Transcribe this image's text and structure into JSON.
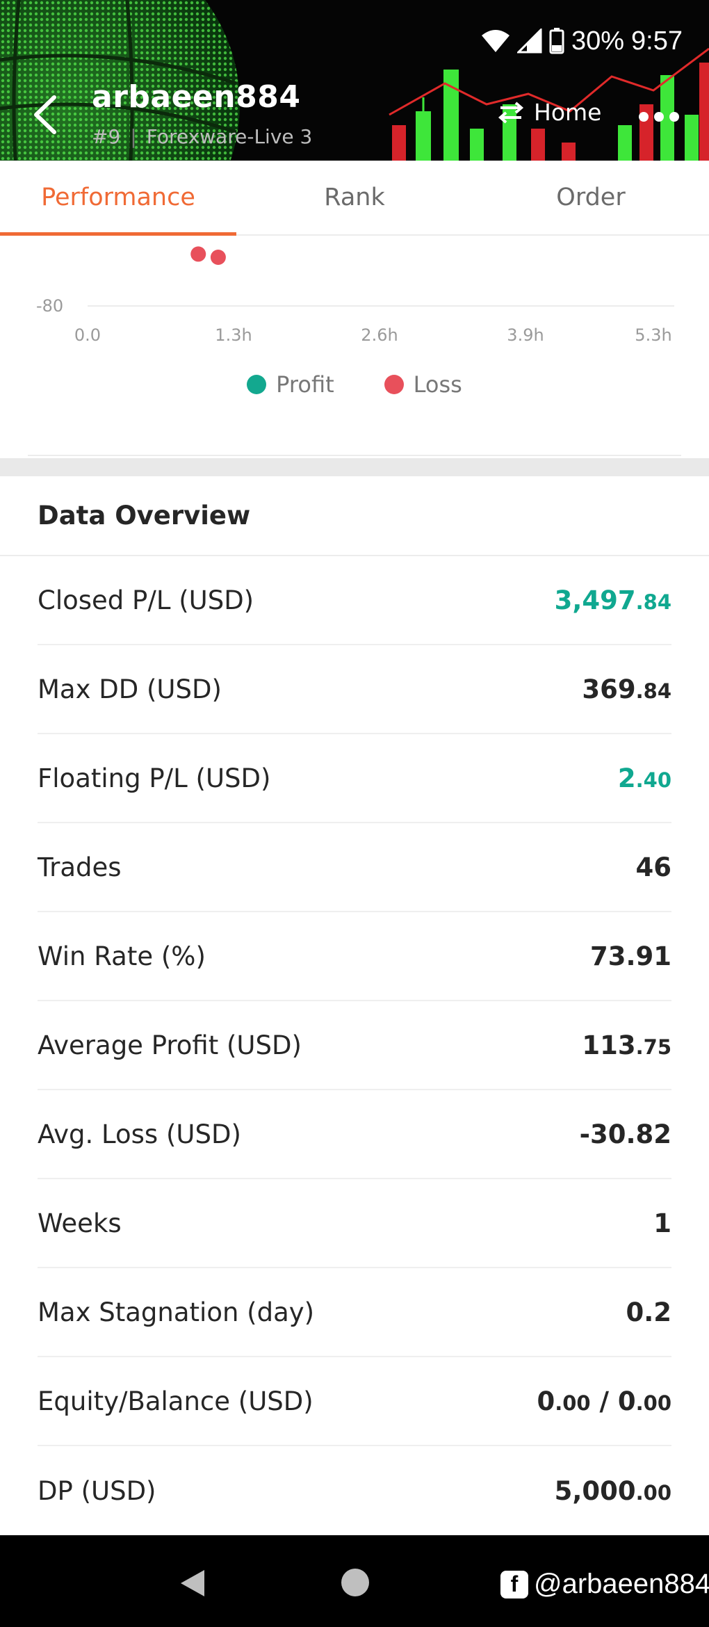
{
  "status_bar": {
    "battery": "30%",
    "time": "9:57"
  },
  "header": {
    "title": "arbaeen884",
    "rank": "#9",
    "server": "Forexware-Live 3",
    "home_label": "Home"
  },
  "tabs": [
    {
      "label": "Performance",
      "active": true
    },
    {
      "label": "Rank",
      "active": false
    },
    {
      "label": "Order",
      "active": false
    }
  ],
  "chart_data": {
    "type": "scatter",
    "y_tick_labels": [
      "-80"
    ],
    "x_tick_labels": [
      "0.0",
      "1.3h",
      "2.6h",
      "3.9h",
      "5.3h"
    ],
    "series": [
      {
        "name": "Profit",
        "color": "#13a88f",
        "points": []
      },
      {
        "name": "Loss",
        "color": "#e8505b",
        "points": [
          {
            "x": 1.0,
            "y": -76
          },
          {
            "x": 1.18,
            "y": -80
          }
        ]
      }
    ],
    "legend_position": "bottom-center",
    "grid": true
  },
  "overview": {
    "title": "Data Overview",
    "rows": [
      {
        "label": "Closed P/L (USD)",
        "int": "3,497",
        "dec": ".84",
        "positive": true
      },
      {
        "label": "Max DD (USD)",
        "int": "369",
        "dec": ".84",
        "positive": false
      },
      {
        "label": "Floating P/L (USD)",
        "int": "2",
        "dec": ".40",
        "positive": true
      },
      {
        "label": "Trades",
        "int": "46",
        "dec": "",
        "positive": false
      },
      {
        "label": "Win Rate (%)",
        "int": "73.91",
        "dec": "",
        "positive": false
      },
      {
        "label": "Average Profit (USD)",
        "int": "113",
        "dec": ".75",
        "positive": false
      },
      {
        "label": "Avg. Loss (USD)",
        "int": "-30.82",
        "dec": "",
        "positive": false
      },
      {
        "label": "Weeks",
        "int": "1",
        "dec": "",
        "positive": false
      },
      {
        "label": "Max Stagnation (day)",
        "int": "0.2",
        "dec": "",
        "positive": false
      },
      {
        "label": "Equity/Balance (USD)",
        "int": "0",
        "dec": ".00",
        "sep": " / ",
        "int2": "0",
        "dec2": ".00",
        "positive": false
      },
      {
        "label": "DP (USD)",
        "int": "5,000",
        "dec": ".00",
        "positive": false
      }
    ]
  },
  "watermark": {
    "text": "@arbaeen884"
  },
  "colors": {
    "accent": "#f06a35",
    "positive": "#10a890",
    "loss": "#e8505b",
    "profit": "#13a88f"
  }
}
